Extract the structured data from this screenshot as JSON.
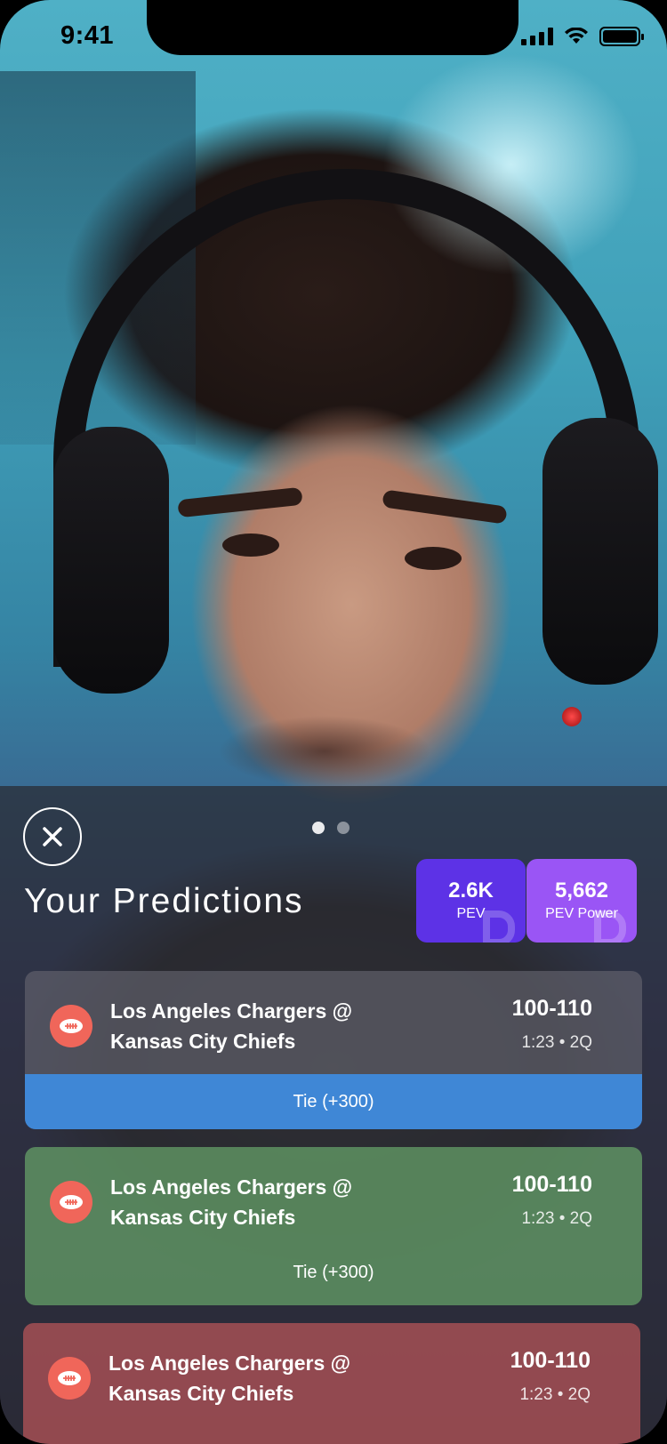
{
  "status_bar": {
    "time": "9:41"
  },
  "sheet": {
    "title": "Your Predictions",
    "pager": {
      "count": 2,
      "active": 0
    },
    "stats": [
      {
        "value": "2.6K",
        "label": "PEV",
        "color": "#5d32e6"
      },
      {
        "value": "5,662",
        "label": "PEV Power",
        "color": "#9a55f5"
      }
    ],
    "cards": [
      {
        "matchup_line1": "Los Angeles Chargers @",
        "matchup_line2": "Kansas City Chiefs",
        "score": "100-110",
        "clock": "1:23 • 2Q",
        "pick": "Tie (+300)",
        "state": "pending",
        "color": "#3f87d6"
      },
      {
        "matchup_line1": "Los Angeles Chargers @",
        "matchup_line2": "Kansas City Chiefs",
        "score": "100-110",
        "clock": "1:23 • 2Q",
        "pick": "Tie (+300)",
        "state": "won",
        "color": "#60966a"
      },
      {
        "matchup_line1": "Los Angeles Chargers @",
        "matchup_line2": "Kansas City Chiefs",
        "score": "100-110",
        "clock": "1:23 • 2Q",
        "state": "lost",
        "color": "#aa5055"
      }
    ]
  },
  "icons": {
    "close": "close-icon",
    "sport": "football-icon"
  }
}
